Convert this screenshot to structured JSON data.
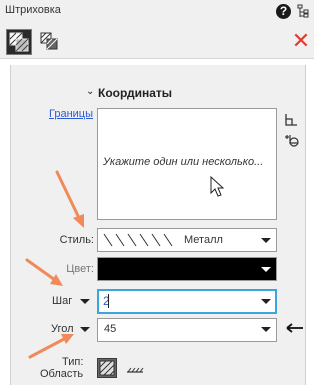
{
  "window": {
    "title": "Штриховка"
  },
  "icons": {
    "help": "question-mark",
    "tree": "tree-structure",
    "hatch_mode": "hatch",
    "hatch_mode_2": "copy-hatch",
    "close": "close-x",
    "corner": "corner-bracket",
    "add_contour": "add-contour",
    "cursor": "mouse-pointer",
    "annotation_left_arrow": "left-arrow"
  },
  "help_glyph": "?",
  "close_glyph": "✕",
  "section": {
    "chevron": "⌄",
    "title": "Координаты"
  },
  "boundaries": {
    "link_label": "Границы",
    "hint": "Укажите один или несколько..."
  },
  "style": {
    "label": "Стиль:",
    "value": "Металл"
  },
  "color": {
    "label": "Цвет:",
    "value_color": "#000000"
  },
  "step": {
    "label": "Шаг",
    "value": "2"
  },
  "angle": {
    "label": "Угол",
    "value": "45"
  },
  "type": {
    "label": "Тип:",
    "area_label": "Область"
  },
  "colors": {
    "accent_focus": "#3aa6e0",
    "close": "#e23b2e",
    "annotation_arrow": "#f08a5a",
    "link": "#2a5bd7"
  }
}
